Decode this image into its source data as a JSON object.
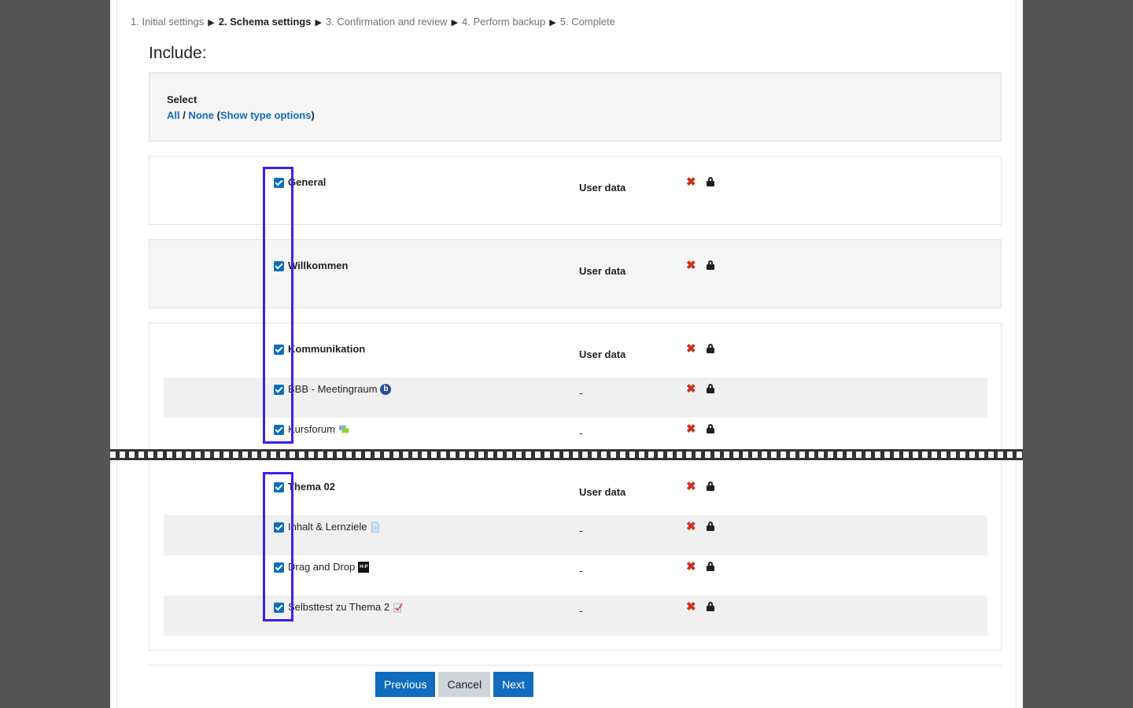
{
  "breadcrumb": {
    "steps": [
      "1. Initial settings",
      "2. Schema settings",
      "3. Confirmation and review",
      "4. Perform backup",
      "5. Complete"
    ],
    "separator": "▶"
  },
  "heading": "Include:",
  "select": {
    "label": "Select",
    "all": "All",
    "slash": " / ",
    "none": "None",
    "open_paren": " (",
    "show_type_options": "Show type options",
    "close_paren": ")"
  },
  "items": {
    "general": {
      "label": "General",
      "userdata": "User data"
    },
    "willkommen": {
      "label": "Willkommen",
      "userdata": "User data"
    },
    "kommunikation": {
      "label": "Kommunikation",
      "userdata": "User data"
    },
    "bbb": {
      "label": "BBB - Meetingraum",
      "userdata": "-"
    },
    "kursforum": {
      "label": "Kursforum",
      "userdata": "-"
    },
    "thema02": {
      "label": "Thema 02",
      "userdata": "User data"
    },
    "inhalt": {
      "label": "Inhalt & Lernziele",
      "userdata": "-"
    },
    "dragdrop": {
      "label": "Drag and Drop",
      "userdata": "-"
    },
    "selbsttest": {
      "label": "Selbsttest zu Thema 2",
      "userdata": "-"
    }
  },
  "icons": {
    "include_mark": "✖",
    "h5p_text": "H-P",
    "bbb_letter": "b"
  },
  "buttons": {
    "previous": "Previous",
    "cancel": "Cancel",
    "next": "Next"
  },
  "colors": {
    "accent": "#0f6cbf",
    "highlight": "#3e1ff0",
    "cross": "#ca3120"
  }
}
